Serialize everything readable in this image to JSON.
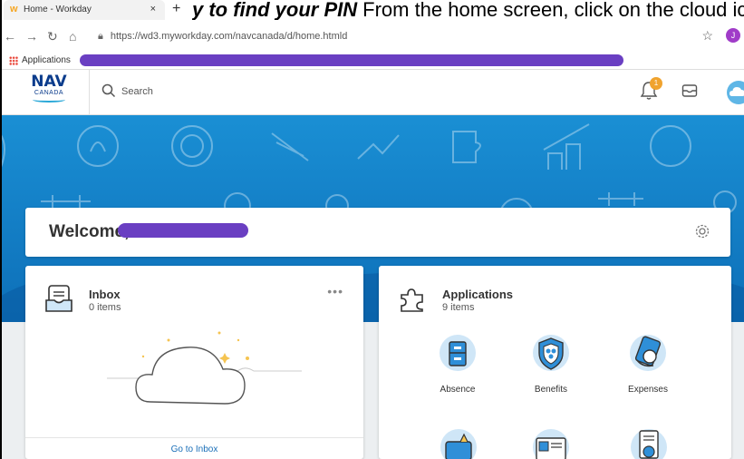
{
  "caption": {
    "bold": "y to find your PIN",
    "rest": "From the home screen, click on the cloud ico"
  },
  "browser": {
    "tab_title": "Home - Workday",
    "tab_close": "×",
    "new_tab": "+",
    "url": "https://wd3.myworkday.com/navcanada/d/home.htmld",
    "bookmark_apps": "Applications",
    "profile_initial": "J"
  },
  "header": {
    "logo_line1": "NAV",
    "logo_line2": "CANADA",
    "search_placeholder": "Search",
    "notification_count": "1"
  },
  "welcome": {
    "text": "Welcome,"
  },
  "inbox": {
    "title": "Inbox",
    "count": "0 items",
    "menu": "•••",
    "goto": "Go to Inbox"
  },
  "applications": {
    "title": "Applications",
    "count": "9 items",
    "tiles": [
      {
        "label": "Absence"
      },
      {
        "label": "Benefits"
      },
      {
        "label": "Expenses"
      }
    ]
  },
  "colors": {
    "accent": "#0d6fb8",
    "brand": "#0b3c8c",
    "redaction": "#6a3fc2",
    "notification": "#f0a32e"
  }
}
